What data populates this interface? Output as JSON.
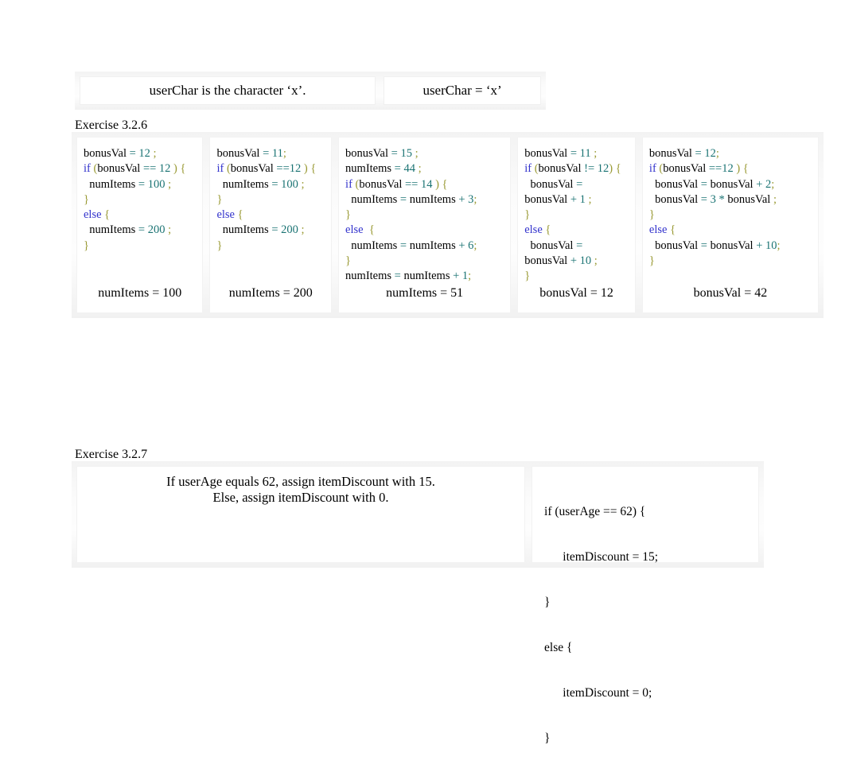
{
  "page": {
    "background": "#ffffff",
    "text_color": "#000000"
  },
  "user_char_table": {
    "name": "userChar-table",
    "left_cell": "userChar is the character ‘x’.",
    "right_cell": "userChar = ‘x’"
  },
  "exercise_326": {
    "label": "Exercise 3.2.6",
    "columns": [
      {
        "answer": "numItems = 100",
        "lines": [
          [
            {
              "t": "bonusVal ",
              "c": "id"
            },
            {
              "t": "= ",
              "c": "op"
            },
            {
              "t": "12",
              "c": "num"
            },
            {
              "t": " ;",
              "c": "punc"
            }
          ],
          [
            {
              "t": "if",
              "c": "kw"
            },
            {
              "t": " (",
              "c": "punc"
            },
            {
              "t": "bonusVal ",
              "c": "id"
            },
            {
              "t": "== ",
              "c": "op"
            },
            {
              "t": "12",
              "c": "num"
            },
            {
              "t": " ) {",
              "c": "punc"
            }
          ],
          [
            {
              "t": "  numItems ",
              "c": "id"
            },
            {
              "t": "= ",
              "c": "op"
            },
            {
              "t": "100",
              "c": "num"
            },
            {
              "t": " ;",
              "c": "punc"
            }
          ],
          [
            {
              "t": "}",
              "c": "punc"
            }
          ],
          [
            {
              "t": "else",
              "c": "kw"
            },
            {
              "t": " {",
              "c": "punc"
            }
          ],
          [
            {
              "t": "  numItems ",
              "c": "id"
            },
            {
              "t": "= ",
              "c": "op"
            },
            {
              "t": "200",
              "c": "num"
            },
            {
              "t": " ;",
              "c": "punc"
            }
          ],
          [
            {
              "t": "}",
              "c": "punc"
            }
          ]
        ]
      },
      {
        "answer": "numItems = 200",
        "lines": [
          [
            {
              "t": "bonusVal ",
              "c": "id"
            },
            {
              "t": "= ",
              "c": "op"
            },
            {
              "t": "11",
              "c": "num"
            },
            {
              "t": ";",
              "c": "punc"
            }
          ],
          [
            {
              "t": "if",
              "c": "kw"
            },
            {
              "t": " (",
              "c": "punc"
            },
            {
              "t": "bonusVal ",
              "c": "id"
            },
            {
              "t": "==",
              "c": "op"
            },
            {
              "t": "12",
              "c": "num"
            },
            {
              "t": " ) {",
              "c": "punc"
            }
          ],
          [
            {
              "t": "  numItems ",
              "c": "id"
            },
            {
              "t": "= ",
              "c": "op"
            },
            {
              "t": "100",
              "c": "num"
            },
            {
              "t": " ;",
              "c": "punc"
            }
          ],
          [
            {
              "t": "}",
              "c": "punc"
            }
          ],
          [
            {
              "t": "else",
              "c": "kw"
            },
            {
              "t": " {",
              "c": "punc"
            }
          ],
          [
            {
              "t": "  numItems ",
              "c": "id"
            },
            {
              "t": "= ",
              "c": "op"
            },
            {
              "t": "200",
              "c": "num"
            },
            {
              "t": " ;",
              "c": "punc"
            }
          ],
          [
            {
              "t": "}",
              "c": "punc"
            }
          ]
        ]
      },
      {
        "answer": "numItems = 51",
        "lines": [
          [
            {
              "t": "bonusVal ",
              "c": "id"
            },
            {
              "t": "= ",
              "c": "op"
            },
            {
              "t": "15",
              "c": "num"
            },
            {
              "t": " ;",
              "c": "punc"
            }
          ],
          [
            {
              "t": "numItems ",
              "c": "id"
            },
            {
              "t": "= ",
              "c": "op"
            },
            {
              "t": "44",
              "c": "num"
            },
            {
              "t": " ;",
              "c": "punc"
            }
          ],
          [
            {
              "t": "if",
              "c": "kw"
            },
            {
              "t": " (",
              "c": "punc"
            },
            {
              "t": "bonusVal ",
              "c": "id"
            },
            {
              "t": "== ",
              "c": "op"
            },
            {
              "t": "14",
              "c": "num"
            },
            {
              "t": " ) {",
              "c": "punc"
            }
          ],
          [
            {
              "t": "  numItems ",
              "c": "id"
            },
            {
              "t": "= ",
              "c": "op"
            },
            {
              "t": "numItems ",
              "c": "id"
            },
            {
              "t": "+ ",
              "c": "op"
            },
            {
              "t": "3",
              "c": "num"
            },
            {
              "t": ";",
              "c": "punc"
            }
          ],
          [
            {
              "t": "}",
              "c": "punc"
            }
          ],
          [
            {
              "t": "else",
              "c": "kw"
            },
            {
              "t": "  {",
              "c": "punc"
            }
          ],
          [
            {
              "t": "  numItems ",
              "c": "id"
            },
            {
              "t": "= ",
              "c": "op"
            },
            {
              "t": "numItems ",
              "c": "id"
            },
            {
              "t": "+ ",
              "c": "op"
            },
            {
              "t": "6",
              "c": "num"
            },
            {
              "t": ";",
              "c": "punc"
            }
          ],
          [
            {
              "t": "}",
              "c": "punc"
            }
          ],
          [
            {
              "t": "numItems ",
              "c": "id"
            },
            {
              "t": "= ",
              "c": "op"
            },
            {
              "t": "numItems ",
              "c": "id"
            },
            {
              "t": "+ ",
              "c": "op"
            },
            {
              "t": "1",
              "c": "num"
            },
            {
              "t": ";",
              "c": "punc"
            }
          ]
        ]
      },
      {
        "answer": "bonusVal = 12",
        "lines": [
          [
            {
              "t": "bonusVal ",
              "c": "id"
            },
            {
              "t": "= ",
              "c": "op"
            },
            {
              "t": "11",
              "c": "num"
            },
            {
              "t": " ;",
              "c": "punc"
            }
          ],
          [
            {
              "t": "if",
              "c": "kw"
            },
            {
              "t": " (",
              "c": "punc"
            },
            {
              "t": "bonusVal ",
              "c": "id"
            },
            {
              "t": "!= ",
              "c": "op"
            },
            {
              "t": "12",
              "c": "num"
            },
            {
              "t": ") {",
              "c": "punc"
            }
          ],
          [
            {
              "t": "  bonusVal ",
              "c": "id"
            },
            {
              "t": "=",
              "c": "op"
            }
          ],
          [
            {
              "t": "bonusVal ",
              "c": "id"
            },
            {
              "t": "+ ",
              "c": "op"
            },
            {
              "t": "1",
              "c": "num"
            },
            {
              "t": " ;",
              "c": "punc"
            }
          ],
          [
            {
              "t": "}",
              "c": "punc"
            }
          ],
          [
            {
              "t": "else",
              "c": "kw"
            },
            {
              "t": " {",
              "c": "punc"
            }
          ],
          [
            {
              "t": "  bonusVal ",
              "c": "id"
            },
            {
              "t": "=",
              "c": "op"
            }
          ],
          [
            {
              "t": "bonusVal ",
              "c": "id"
            },
            {
              "t": "+ ",
              "c": "op"
            },
            {
              "t": "10",
              "c": "num"
            },
            {
              "t": " ;",
              "c": "punc"
            }
          ],
          [
            {
              "t": "}",
              "c": "punc"
            }
          ]
        ]
      },
      {
        "answer": "bonusVal = 42",
        "lines": [
          [
            {
              "t": "bonusVal ",
              "c": "id"
            },
            {
              "t": "= ",
              "c": "op"
            },
            {
              "t": "12",
              "c": "num"
            },
            {
              "t": ";",
              "c": "punc"
            }
          ],
          [
            {
              "t": "if",
              "c": "kw"
            },
            {
              "t": " (",
              "c": "punc"
            },
            {
              "t": "bonusVal ",
              "c": "id"
            },
            {
              "t": "==",
              "c": "op"
            },
            {
              "t": "12",
              "c": "num"
            },
            {
              "t": " ) {",
              "c": "punc"
            }
          ],
          [
            {
              "t": "  bonusVal ",
              "c": "id"
            },
            {
              "t": "= ",
              "c": "op"
            },
            {
              "t": "bonusVal ",
              "c": "id"
            },
            {
              "t": "+ ",
              "c": "op"
            },
            {
              "t": "2",
              "c": "num"
            },
            {
              "t": ";",
              "c": "punc"
            }
          ],
          [
            {
              "t": "  bonusVal ",
              "c": "id"
            },
            {
              "t": "= ",
              "c": "op"
            },
            {
              "t": "3",
              "c": "num"
            },
            {
              "t": " * ",
              "c": "op"
            },
            {
              "t": "bonusVal ",
              "c": "id"
            },
            {
              "t": ";",
              "c": "punc"
            }
          ],
          [
            {
              "t": "}",
              "c": "punc"
            }
          ],
          [
            {
              "t": "else",
              "c": "kw"
            },
            {
              "t": " {",
              "c": "punc"
            }
          ],
          [
            {
              "t": "  bonusVal ",
              "c": "id"
            },
            {
              "t": "= ",
              "c": "op"
            },
            {
              "t": "bonusVal ",
              "c": "id"
            },
            {
              "t": "+ ",
              "c": "op"
            },
            {
              "t": "10",
              "c": "num"
            },
            {
              "t": ";",
              "c": "punc"
            }
          ],
          [
            {
              "t": "}",
              "c": "punc"
            }
          ]
        ]
      }
    ]
  },
  "exercise_327": {
    "label": "Exercise 3.2.7",
    "prompt_lines": [
      "If userAge equals 62, assign itemDiscount with 15.",
      "Else, assign itemDiscount with 0."
    ],
    "code_lines": [
      "if (userAge == 62) {",
      "      itemDiscount = 15;",
      "}",
      "else {",
      "      itemDiscount = 0;",
      "}"
    ]
  },
  "colors": {
    "keyword": "#3333cc",
    "number": "#1a7373",
    "operator": "#1a7373",
    "punctuation": "#999933",
    "identifier": "#000000"
  }
}
